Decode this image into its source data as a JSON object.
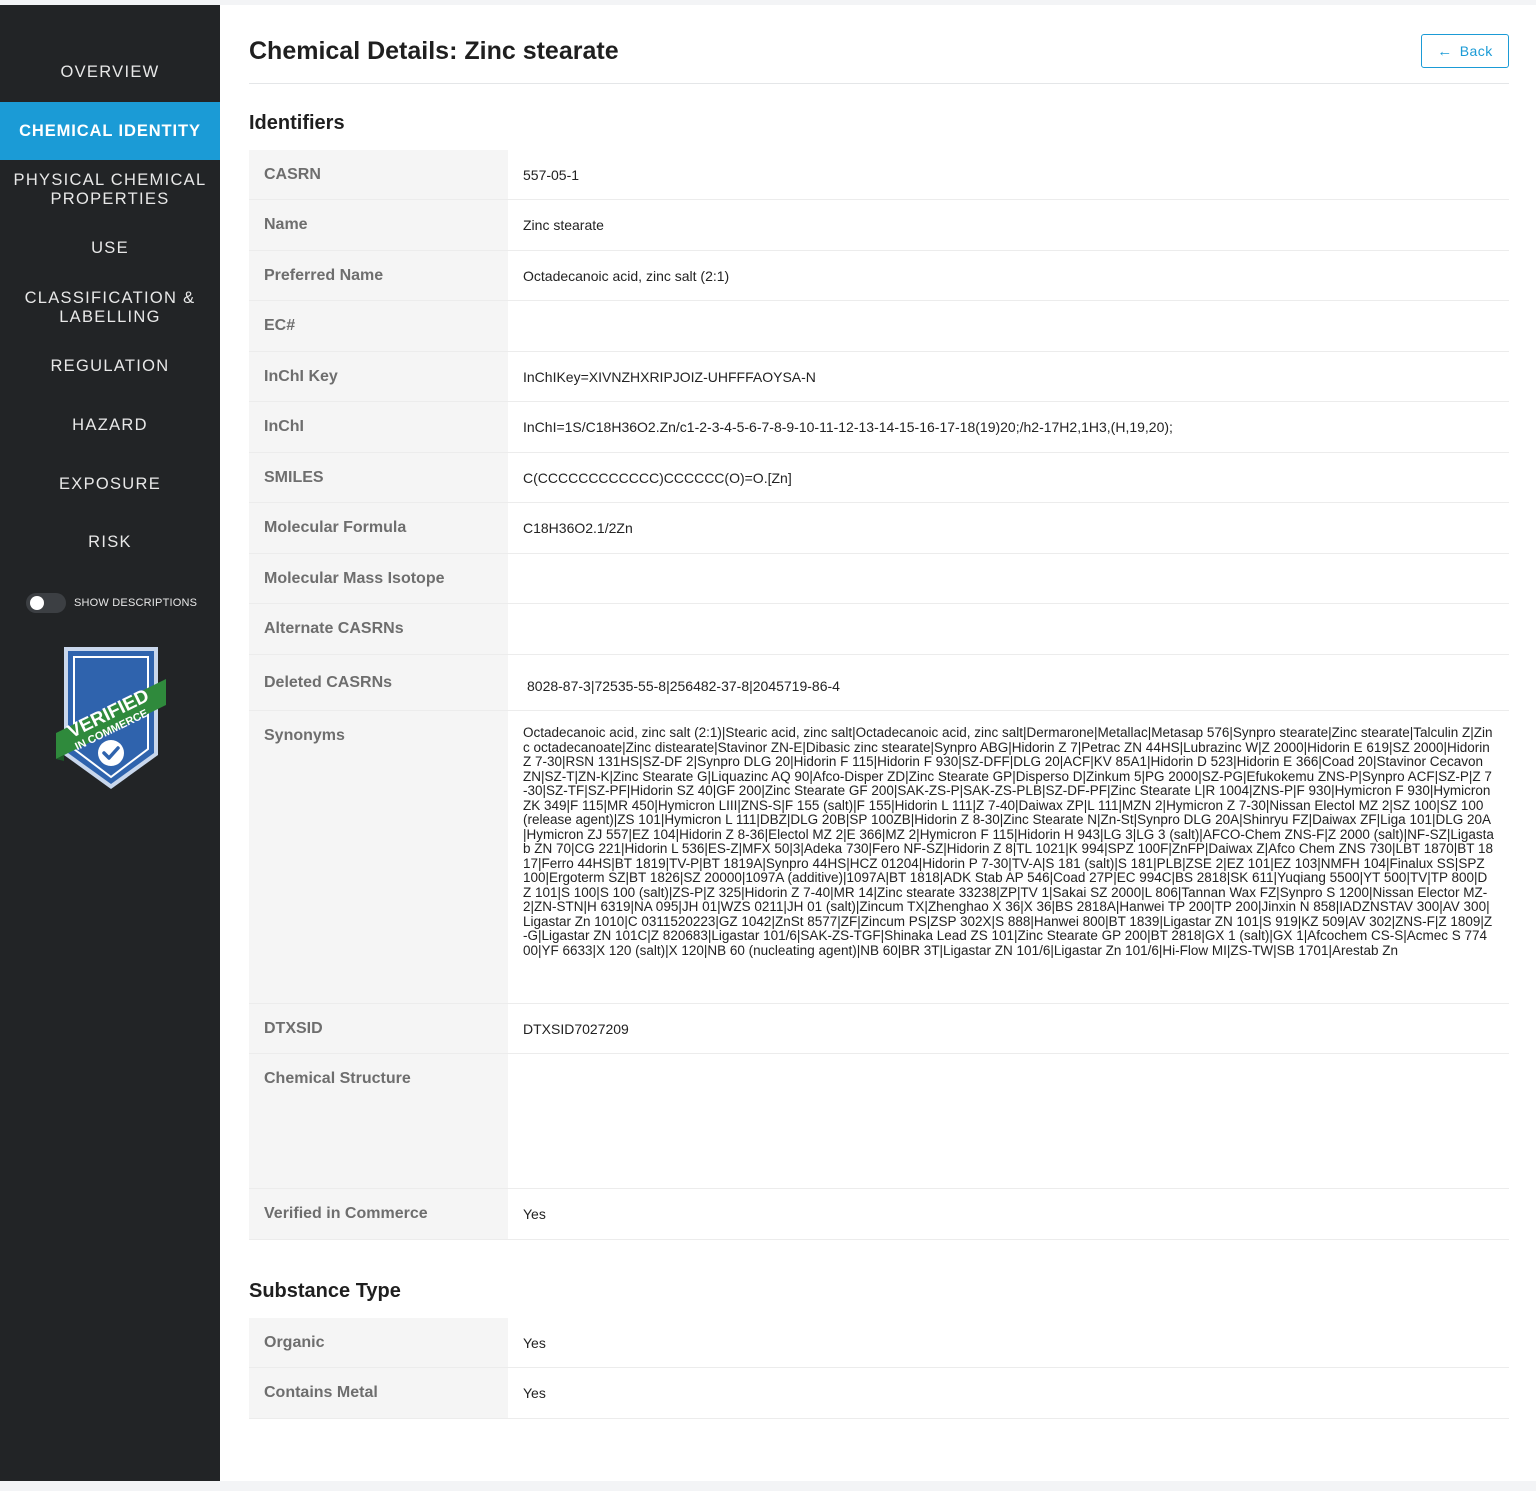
{
  "sidebar": {
    "items": [
      {
        "label": "OVERVIEW"
      },
      {
        "label": "CHEMICAL IDENTITY"
      },
      {
        "label": "PHYSICAL CHEMICAL PROPERTIES"
      },
      {
        "label": "USE"
      },
      {
        "label": "CLASSIFICATION & LABELLING"
      },
      {
        "label": "REGULATION"
      },
      {
        "label": "HAZARD"
      },
      {
        "label": "EXPOSURE"
      },
      {
        "label": "RISK"
      }
    ],
    "active_item": "CHEMICAL IDENTITY",
    "toggle_label": "SHOW DESCRIPTIONS",
    "badge_line1": "VERIFIED",
    "badge_line2": "IN COMMERCE",
    "colors": {
      "background": "#222426",
      "active": "#1b9bd6"
    }
  },
  "header": {
    "title": "Chemical Details: Zinc stearate",
    "back_label": "Back"
  },
  "identifiers": {
    "title": "Identifiers",
    "rows": [
      {
        "label": "CASRN",
        "value": "557-05-1"
      },
      {
        "label": "Name",
        "value": "Zinc stearate"
      },
      {
        "label": "Preferred Name",
        "value": "Octadecanoic acid, zinc salt (2:1)"
      },
      {
        "label": "EC#",
        "value": ""
      },
      {
        "label": "InChI Key",
        "value": "InChIKey=XIVNZHXRIPJOIZ-UHFFFAOYSA-N"
      },
      {
        "label": "InChI",
        "value": "InChI=1S/C18H36O2.Zn/c1-2-3-4-5-6-7-8-9-10-11-12-13-14-15-16-17-18(19)20;/h2-17H2,1H3,(H,19,20);"
      },
      {
        "label": "SMILES",
        "value": "C(CCCCCCCCCCCC)CCCCCC(O)=O.[Zn]"
      },
      {
        "label": "Molecular Formula",
        "value": "C18H36O2.1/2Zn"
      },
      {
        "label": "Molecular Mass Isotope",
        "value": ""
      },
      {
        "label": "Alternate CASRNs",
        "value": ""
      },
      {
        "label": "Deleted CASRNs",
        "value": "8028-87-3|72535-55-8|256482-37-8|2045719-86-4"
      },
      {
        "label": "Synonyms",
        "value": "Octadecanoic acid, zinc salt (2:1)|Stearic acid, zinc salt|Octadecanoic acid, zinc salt|Dermarone|Metallac|Metasap 576|Synpro stearate|Zinc stearate|Talculin Z|Zinc octadecanoate|Zinc distearate|Stavinor ZN-E|Dibasic zinc stearate|Synpro ABG|Hidorin Z 7|Petrac ZN 44HS|Lubrazinc W|Z 2000|Hidorin E 619|SZ 2000|Hidorin Z 7-30|RSN 131HS|SZ-DF 2|Synpro DLG 20|Hidorin F 115|Hidorin F 930|SZ-DFF|DLG 20|ACF|KV 85A1|Hidorin D 523|Hidorin E 366|Coad 20|Stavinor Cecavon ZN|SZ-T|ZN-K|Zinc Stearate G|Liquazinc AQ 90|Afco-Disper ZD|Zinc Stearate GP|Disperso D|Zinkum 5|PG 2000|SZ-PG|Efukokemu ZNS-P|Synpro ACF|SZ-P|Z 7-30|SZ-TF|SZ-PF|Hidorin SZ 40|GF 200|Zinc Stearate GF 200|SAK-ZS-P|SAK-ZS-PLB|SZ-DF-PF|Zinc Stearate L|R 1004|ZNS-P|F 930|Hymicron F 930|Hymicron ZK 349|F 115|MR 450|Hymicron LIII|ZNS-S|F 155 (salt)|F 155|Hidorin L 111|Z 7-40|Daiwax ZP|L 111|MZN 2|Hymicron Z 7-30|Nissan Electol MZ 2|SZ 100|SZ 100 (release agent)|ZS 101|Hymicron L 111|DBZ|DLG 20B|SP 100ZB|Hidorin Z 8-30|Zinc Stearate N|Zn-St|Synpro DLG 20A|Shinryu FZ|Daiwax ZF|Liga 101|DLG 20A|Hymicron ZJ 557|EZ 104|Hidorin Z 8-36|Electol MZ 2|E 366|MZ 2|Hymicron F 115|Hidorin H 943|LG 3|LG 3 (salt)|AFCO-Chem ZNS-F|Z 2000 (salt)|NF-SZ|Ligastab ZN 70|CG 221|Hidorin L 536|ES-Z|MFX 50|3|Adeka 730|Fero NF-SZ|Hidorin Z 8|TL 1021|K 994|SPZ 100F|ZnFP|Daiwax Z|Afco Chem ZNS 730|LBT 1870|BT 1817|Ferro 44HS|BT 1819|TV-P|BT 1819A|Synpro 44HS|HCZ 01204|Hidorin P 7-30|TV-A|S 181 (salt)|S 181|PLB|ZSE 2|EZ 101|EZ 103|NMFH 104|Finalux SS|SPZ 100|Ergoterm SZ|BT 1826|SZ 20000|1097A (additive)|1097A|BT 1818|ADK Stab AP 546|Coad 27P|EC 994C|BS 2818|SK 611|Yuqiang 5500|YT 500|TV|TP 800|DZ 101|S 100|S 100 (salt)|ZS-P|Z 325|Hidorin Z 7-40|MR 14|Zinc stearate 33238|ZP|TV 1|Sakai SZ 2000|L 806|Tannan Wax FZ|Synpro S 1200|Nissan Elector MZ-2|ZN-STN|H 6319|NA 095|JH 01|WZS 0211|JH 01 (salt)|Zincum TX|Zhenghao X 36|X 36|BS 2818A|Hanwei TP 200|TP 200|Jinxin N 858|IADZNSTAV 300|AV 300|Ligastar Zn 1010|C 0311520223|GZ 1042|ZnSt 8577|ZF|Zincum PS|ZSP 302X|S 888|Hanwei 800|BT 1839|Ligastar ZN 101|S 919|KZ 509|AV 302|ZNS-F|Z 1809|Z-G|Ligastar ZN 101C|Z 820683|Ligastar 101/6|SAK-ZS-TGF|Shinaka Lead ZS 101|Zinc Stearate GP 200|BT 2818|GX 1 (salt)|GX 1|Afcochem CS-S|Acmec S 77400|YF 6633|X 120 (salt)|X 120|NB 60 (nucleating agent)|NB 60|BR 3T|Ligastar ZN 101/6|Ligastar Zn 101/6|Hi-Flow MI|ZS-TW|SB 1701|Arestab Zn"
      },
      {
        "label": "DTXSID",
        "value": "DTXSID7027209"
      },
      {
        "label": "Chemical Structure",
        "value": ""
      },
      {
        "label": "Verified in Commerce",
        "value": "Yes"
      }
    ]
  },
  "substance_type": {
    "title": "Substance Type",
    "rows": [
      {
        "label": "Organic",
        "value": "Yes"
      },
      {
        "label": "Contains Metal",
        "value": "Yes"
      }
    ]
  }
}
